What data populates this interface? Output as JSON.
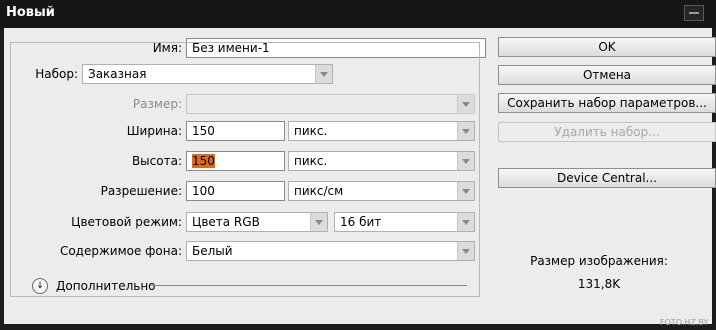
{
  "window": {
    "title": "Новый"
  },
  "name_field": {
    "label": "Имя:",
    "value": "Без имени-1"
  },
  "preset": {
    "label": "Набор:",
    "value": "Заказная"
  },
  "size": {
    "label": "Размер:",
    "value": ""
  },
  "width": {
    "label": "Ширина:",
    "value": "150",
    "unit": "пикс."
  },
  "height": {
    "label": "Высота:",
    "value": "150",
    "unit": "пикс."
  },
  "resolution": {
    "label": "Разрешение:",
    "value": "100",
    "unit": "пикс/см"
  },
  "color_mode": {
    "label": "Цветовой режим:",
    "value": "Цвета RGB",
    "bits": "16 бит"
  },
  "background": {
    "label": "Содержимое фона:",
    "value": "Белый"
  },
  "advanced": {
    "label": "Дополнительно"
  },
  "buttons": {
    "ok": "OK",
    "cancel": "Отмена",
    "save_preset": "Сохранить набор параметров...",
    "delete_preset": "Удалить набор...",
    "device_central": "Device Central..."
  },
  "image_size": {
    "label": "Размер изображения:",
    "value": "131,8K"
  },
  "watermark": "FOTO.HZ.BY",
  "colors": {
    "highlight": "#e06a10",
    "titlebar": "#161616"
  }
}
